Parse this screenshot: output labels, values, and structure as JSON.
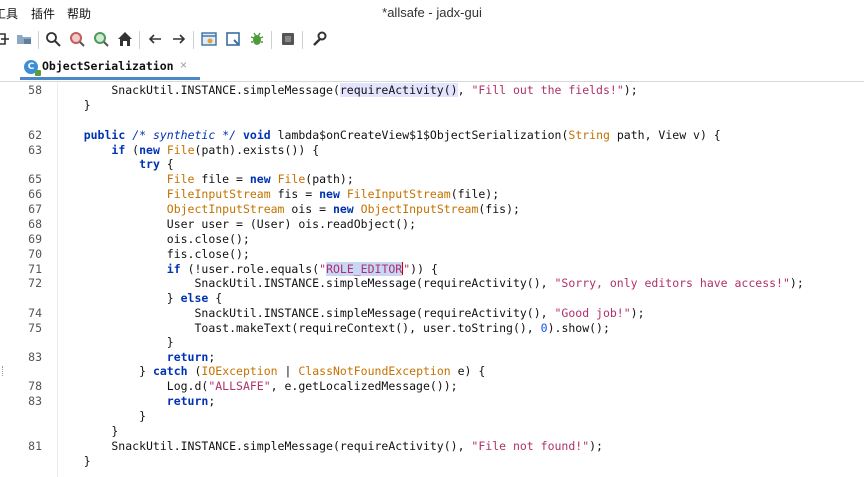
{
  "menubar": {
    "items": [
      "工具",
      "插件",
      "帮助"
    ]
  },
  "window": {
    "title": "*allsafe - jadx-gui"
  },
  "toolbar": {
    "buttons": [
      "sync-icon",
      "folder-icon",
      "search-icon",
      "find-class-icon",
      "find-usage-icon",
      "home-icon",
      "back-icon",
      "forward-icon",
      "decompile-icon",
      "bookmark-icon",
      "debug-bug-icon",
      "stop-icon",
      "settings-wrench-icon"
    ]
  },
  "tab": {
    "label": "ObjectSerialization",
    "close": "×",
    "icon_letter": "C"
  },
  "editor": {
    "lines": [
      {
        "n": "58",
        "code": "line58"
      },
      {
        "n": "",
        "code": "close1"
      },
      {
        "n": "",
        "code": "blank"
      },
      {
        "n": "62",
        "code": "line62"
      },
      {
        "n": "63",
        "code": "line63"
      },
      {
        "n": "",
        "code": "try"
      },
      {
        "n": "65",
        "code": "line65"
      },
      {
        "n": "66",
        "code": "line66"
      },
      {
        "n": "67",
        "code": "line67"
      },
      {
        "n": "68",
        "code": "line68"
      },
      {
        "n": "69",
        "code": "line69"
      },
      {
        "n": "70",
        "code": "line70"
      },
      {
        "n": "71",
        "code": "line71"
      },
      {
        "n": "72",
        "code": "line72"
      },
      {
        "n": "",
        "code": "else"
      },
      {
        "n": "74",
        "code": "line74"
      },
      {
        "n": "75",
        "code": "line75"
      },
      {
        "n": "",
        "code": "close2"
      },
      {
        "n": "83",
        "code": "line83a"
      },
      {
        "n": "",
        "code": "catch"
      },
      {
        "n": "78",
        "code": "line78"
      },
      {
        "n": "83",
        "code": "line83b"
      },
      {
        "n": "",
        "code": "close3"
      },
      {
        "n": "",
        "code": "close4"
      },
      {
        "n": "81",
        "code": "line81"
      },
      {
        "n": "",
        "code": "close5"
      }
    ],
    "strings": {
      "fill_fields": "\"Fill out the fields!\"",
      "role_editor": "ROLE_EDITOR",
      "sorry": "\"Sorry, only editors have access!\"",
      "good_job": "\"Good job!\"",
      "allsafe": "\"ALLSAFE\"",
      "file_not_found": "\"File not found!\""
    }
  },
  "colors": {
    "keyword": "#0033b3",
    "type": "#c47200",
    "string": "#b0306a",
    "tab_accent": "#4a88c7"
  }
}
